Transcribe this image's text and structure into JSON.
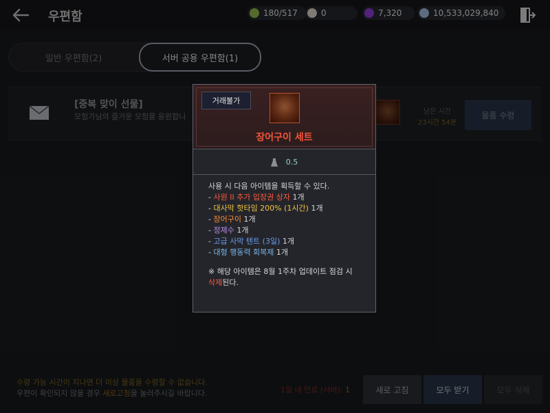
{
  "header": {
    "title": "우편함",
    "currencies": [
      {
        "icon": "energy-icon",
        "value": "180/517",
        "color": "#8db84a"
      },
      {
        "icon": "pearl-icon",
        "value": "0",
        "color": "#d9d2c8"
      },
      {
        "icon": "purple-crystal-icon",
        "value": "7,320",
        "color": "#8a3cd6"
      },
      {
        "icon": "silver-coin-icon",
        "value": "10,533,029,840",
        "color": "#9fb8d8"
      }
    ]
  },
  "tabs": [
    {
      "label": "일반 우편함(2)",
      "active": false
    },
    {
      "label": "서버 공용 우편함(1)",
      "active": true
    }
  ],
  "mail": {
    "title": "[중복 맞이 선물]",
    "description": "모험가님의 즐거운 모험을 응원합니",
    "remaining_label": "남은 시간",
    "remaining_value": "23시간 54분",
    "receive_label": "물품 수령"
  },
  "tooltip": {
    "badge": "거래불가",
    "item_name": "장어구이 세트",
    "weight": "0.5",
    "intro": "사용 시 다음 아이템을 획득할 수 있다.",
    "rewards": [
      {
        "name": "사원 II 추가 입장권 상자",
        "qty": "1개",
        "color": "red"
      },
      {
        "name": "대사막 핫타임 200% (1시간)",
        "qty": "1개",
        "color": "yellow"
      },
      {
        "name": "장어구이",
        "qty": "1개",
        "color": "orange"
      },
      {
        "name": "정제수",
        "qty": "1개",
        "color": "purple"
      },
      {
        "name": "고급 사막 텐트 (3일)",
        "qty": "1개",
        "color": "blue"
      },
      {
        "name": "대형 행동력 회복제",
        "qty": "1개",
        "color": "cyan"
      }
    ],
    "note_prefix": "※ 해당 아이템은 8월 1주차 업데이트 점검 시",
    "note_highlight": "삭제",
    "note_suffix": "된다."
  },
  "footer": {
    "notice_line1": "수령 가능 시간이 지나면 더 이상 물품을 수령할 수 없습니다.",
    "notice_line2_prefix": "우편이 확인되지 않을 경우 ",
    "notice_line2_highlight": "새로고침",
    "notice_line2_suffix": "을 눌러주시길 바랍니다.",
    "expire_label": "1일 내 만료 (서버): ",
    "expire_count": "1",
    "refresh_label": "새로 고침",
    "receive_all_label": "모두 받기",
    "delete_all_label": "모두 삭제"
  }
}
